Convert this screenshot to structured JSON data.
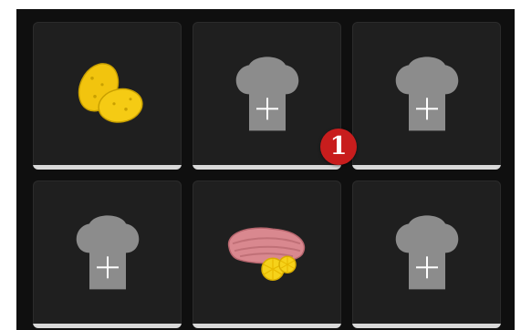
{
  "colors": {
    "background": "#0f0f0f",
    "tile": "#1f1f1f",
    "tile_bar": "#d9d9d9",
    "chef_hat": "#8c8c8c",
    "badge": "#c81d1d"
  },
  "tiles": [
    {
      "content": "potato-slices"
    },
    {
      "content": "empty-add-slot",
      "icon": "chef-hat-plus-icon"
    },
    {
      "content": "empty-add-slot",
      "icon": "chef-hat-plus-icon"
    },
    {
      "content": "empty-add-slot",
      "icon": "chef-hat-plus-icon"
    },
    {
      "content": "fish-with-lemon"
    },
    {
      "content": "empty-add-slot",
      "icon": "chef-hat-plus-icon"
    }
  ],
  "badge": {
    "text": "1"
  }
}
